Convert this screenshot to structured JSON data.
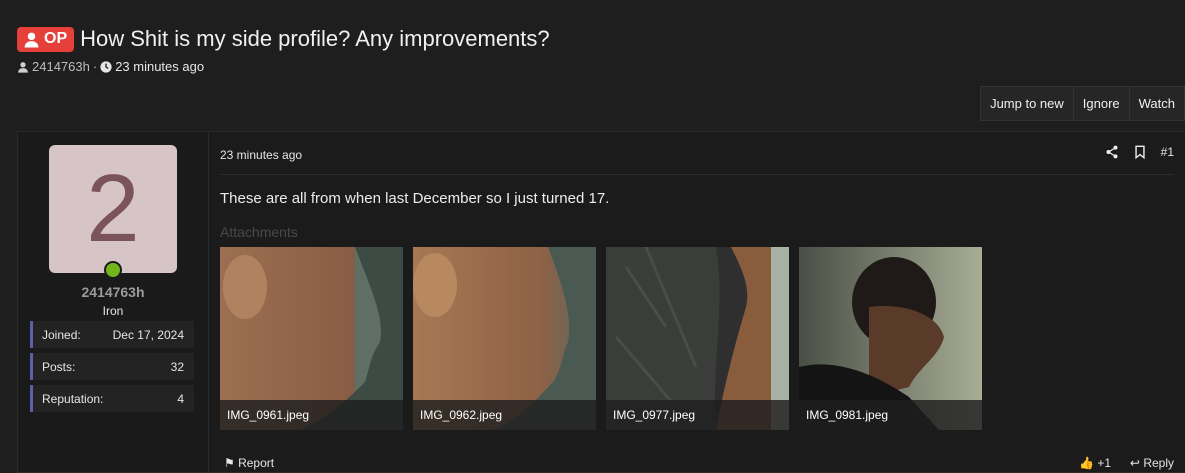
{
  "thread": {
    "badge": "OP",
    "title": "How Shit is my side profile? Any improvements?",
    "author": "2414763h",
    "separator": "·",
    "time": "23 minutes ago"
  },
  "actions": {
    "jump_to_new": "Jump to new",
    "ignore": "Ignore",
    "watch": "Watch"
  },
  "user": {
    "avatar_letter": "2",
    "name": "2414763h",
    "rank": "Iron",
    "stats": [
      {
        "label": "Joined:",
        "value": "Dec 17, 2024"
      },
      {
        "label": "Posts:",
        "value": "32"
      },
      {
        "label": "Reputation:",
        "value": "4"
      }
    ]
  },
  "post": {
    "time": "23 minutes ago",
    "number": "#1",
    "body": "These are all from when last December so I just turned 17.",
    "attachments_label": "Attachments",
    "attachments": [
      {
        "name": "IMG_0961.jpeg"
      },
      {
        "name": "IMG_0962.jpeg"
      },
      {
        "name": "IMG_0977.jpeg"
      },
      {
        "name": "IMG_0981.jpeg"
      }
    ],
    "report_label": "Report",
    "like_label": "+1",
    "reply_label": "Reply"
  },
  "colors": {
    "background": "#1e1e1e",
    "op_badge": "#e5413a",
    "avatar_bg": "#d6c4c6",
    "avatar_fg": "#7a5459",
    "online": "#72b51b",
    "stat_accent": "#5a5fa8"
  }
}
